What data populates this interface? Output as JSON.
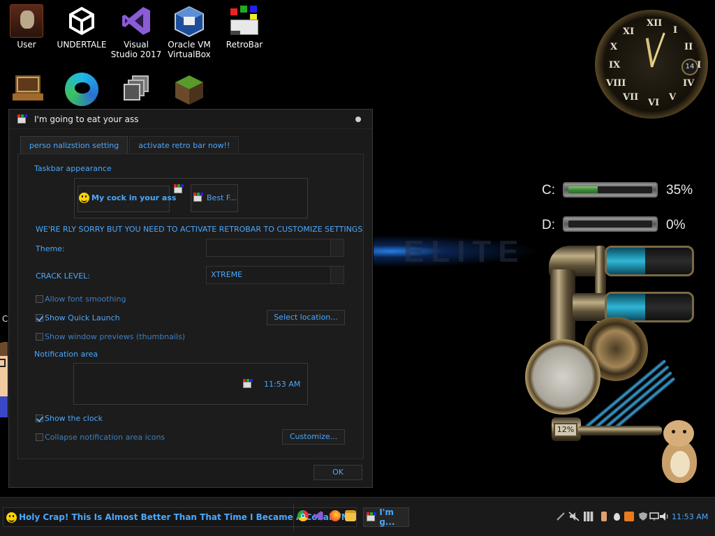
{
  "desktop": {
    "icons": [
      {
        "label": "User",
        "icon": "user-folder-icon"
      },
      {
        "label": "UNDERTALE",
        "icon": "unity-icon"
      },
      {
        "label": "Visual Studio 2017",
        "icon": "visual-studio-icon"
      },
      {
        "label": "Oracle VM VirtualBox",
        "icon": "virtualbox-icon"
      },
      {
        "label": "RetroBar",
        "icon": "retrobar-icon"
      },
      {
        "label": "",
        "icon": "computer-icon"
      },
      {
        "label": "",
        "icon": "edge-icon"
      },
      {
        "label": "",
        "icon": "windows-stack-icon"
      },
      {
        "label": "",
        "icon": "minecraft-icon"
      }
    ],
    "side_char": "C"
  },
  "widgets": {
    "clock": {
      "numerals": [
        "XII",
        "I",
        "II",
        "III",
        "IV",
        "V",
        "VI",
        "VII",
        "VIII",
        "IX",
        "X",
        "XI"
      ],
      "date": "14"
    },
    "drives": [
      {
        "label": "C:",
        "percent": "35%",
        "fill": 0.35
      },
      {
        "label": "D:",
        "percent": "0%",
        "fill": 0.0
      }
    ],
    "gauge_counter": "12%",
    "tanks": [
      {
        "fill": 0.45
      },
      {
        "fill": 0.45
      }
    ]
  },
  "dialog": {
    "title": "I'm going to eat your ass",
    "tabs": [
      {
        "label": "perso nalizstion setting",
        "active": true
      },
      {
        "label": "activate retro bar now!!",
        "active": false
      }
    ],
    "taskbar_appearance": {
      "title": "Taskbar appearance",
      "preview_start": "My cock in your ass",
      "preview_task": "Best F..."
    },
    "notice": "WE'RE RLY SORRY BUT YOU NEED TO ACTIVATE RETROBAR TO CUSTOMIZE SETTINGS",
    "theme": {
      "label": "Theme:",
      "value": ""
    },
    "crack_level": {
      "label": "CRACK LEVEL:",
      "value": "XTREME"
    },
    "options": {
      "font_smoothing": {
        "label": "Allow font smoothing",
        "checked": false
      },
      "quick_launch": {
        "label": "Show Quick Launch",
        "checked": true
      },
      "thumbnails": {
        "label": "Show window previews (thumbnails)",
        "checked": false
      }
    },
    "select_location_label": "Select location...",
    "notification_area": {
      "title": "Notification area",
      "preview_time": "11:53 AM",
      "show_clock": {
        "label": "Show the clock",
        "checked": true
      },
      "collapse_icons": {
        "label": "Collapse notification area icons",
        "checked": false
      },
      "customize_label": "Customize..."
    },
    "ok_label": "OK"
  },
  "taskbar": {
    "start_label": "Holy Crap! This Is Almost Better Than That Time I Became A CollabVM!",
    "quick_launch": [
      "chrome-icon",
      "visual-studio-icon",
      "firefox-icon",
      "file-explorer-icon"
    ],
    "task_label": "I'm g...",
    "tray_icons": [
      "pen-icon",
      "mute-icon",
      "qr-icon",
      "bottle-icon",
      "drop-icon",
      "flame-icon",
      "shield-icon",
      "network-icon",
      "volume-icon"
    ],
    "clock": "11:53 AM"
  },
  "colors": {
    "accent": "#4aa8ff",
    "background": "#1a1a1a"
  }
}
